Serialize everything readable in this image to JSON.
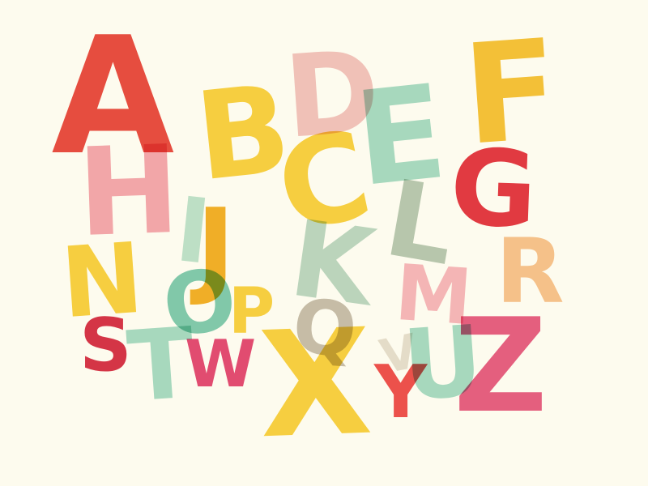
{
  "scene": {
    "background_color": "#fdfbee",
    "letters": [
      {
        "key": "A",
        "char": "A",
        "color": "#e84e43"
      },
      {
        "key": "D",
        "char": "D",
        "color": "#f2c4c4"
      },
      {
        "key": "F",
        "char": "F",
        "color": "#f5c33b"
      },
      {
        "key": "E",
        "char": "E",
        "color": "#a8dccb"
      },
      {
        "key": "B",
        "char": "B",
        "color": "#f8d244"
      },
      {
        "key": "H",
        "char": "H",
        "color": "#f4a9b4"
      },
      {
        "key": "C",
        "char": "C",
        "color": "#f8d244"
      },
      {
        "key": "G",
        "char": "G",
        "color": "#e33b45"
      },
      {
        "key": "I",
        "char": "I",
        "color": "#bfe3d3"
      },
      {
        "key": "J",
        "char": "J",
        "color": "#f2b129"
      },
      {
        "key": "L",
        "char": "L",
        "color": "#b9c9b8"
      },
      {
        "key": "K",
        "char": "K",
        "color": "#bdd8c9"
      },
      {
        "key": "R",
        "char": "R",
        "color": "#f7c493"
      },
      {
        "key": "N",
        "char": "N",
        "color": "#f8d244"
      },
      {
        "key": "M",
        "char": "M",
        "color": "#f6b8c2"
      },
      {
        "key": "O",
        "char": "O",
        "color": "#82cbb5"
      },
      {
        "key": "P",
        "char": "P",
        "color": "#f8d244"
      },
      {
        "key": "Q",
        "char": "Q",
        "color": "#c8bfb2"
      },
      {
        "key": "S",
        "char": "S",
        "color": "#d6364b"
      },
      {
        "key": "T",
        "char": "T",
        "color": "#a8dccb"
      },
      {
        "key": "W",
        "char": "W",
        "color": "#e34d78"
      },
      {
        "key": "U",
        "char": "U",
        "color": "#a8dccb"
      },
      {
        "key": "V",
        "char": "V",
        "color": "#e6e0d7"
      },
      {
        "key": "Y",
        "char": "Y",
        "color": "#ee5250"
      },
      {
        "key": "X",
        "char": "X",
        "color": "#f8d244"
      },
      {
        "key": "Z",
        "char": "Z",
        "color": "#e66087"
      }
    ]
  }
}
